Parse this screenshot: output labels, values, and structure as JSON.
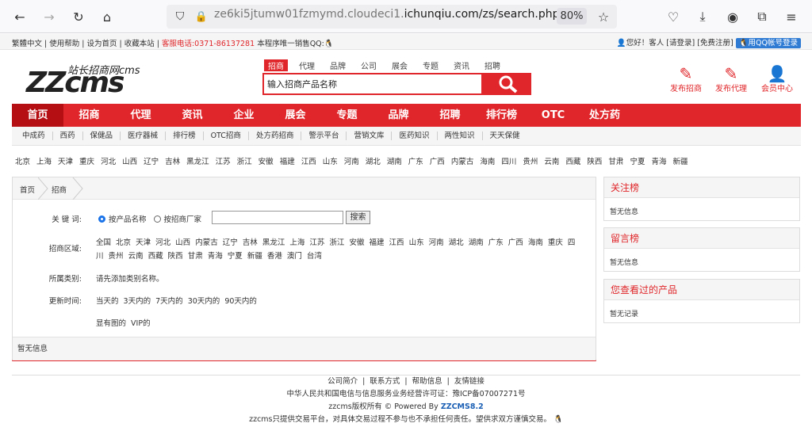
{
  "browser": {
    "url_dim": "ze6ki5jtumw01fzmymd.cloudeci1.",
    "url_main": "ichunqiu.com/zs/search.php",
    "zoom": "80%"
  },
  "topbar": {
    "links": "繁體中文 | 使用帮助 | 设为首页 | 收藏本站 |",
    "phone": "客服电话:0371-86137281",
    "qq_text": "本程序唯一销售QQ:",
    "greeting": "您好！客人",
    "login": "[请登录]",
    "register": "[免费注册]",
    "qq_login": "用QQ帐号登录"
  },
  "logo": {
    "main": "ZZcms",
    "sub": "站长招商网cms"
  },
  "search": {
    "tabs": [
      "招商",
      "代理",
      "品牌",
      "公司",
      "展会",
      "专题",
      "资讯",
      "招聘"
    ],
    "placeholder": "输入招商产品名称"
  },
  "right_links": [
    "发布招商",
    "发布代理",
    "会员中心"
  ],
  "nav": [
    "首页",
    "招商",
    "代理",
    "资讯",
    "企业",
    "展会",
    "专题",
    "品牌",
    "招聘",
    "排行榜",
    "OTC",
    "处方药"
  ],
  "subnav": [
    "中成药",
    "西药",
    "保健品",
    "医疗器械",
    "排行榜",
    "OTC招商",
    "处方药招商",
    "警示平台",
    "营销文库",
    "医药知识",
    "两性知识",
    "天天保健"
  ],
  "cities": [
    "北京",
    "上海",
    "天津",
    "重庆",
    "河北",
    "山西",
    "辽宁",
    "吉林",
    "黑龙江",
    "江苏",
    "浙江",
    "安徽",
    "福建",
    "江西",
    "山东",
    "河南",
    "湖北",
    "湖南",
    "广东",
    "广西",
    "内蒙古",
    "海南",
    "四川",
    "贵州",
    "云南",
    "西藏",
    "陕西",
    "甘肃",
    "宁夏",
    "青海",
    "新疆"
  ],
  "breadcrumb": [
    "首页",
    "招商"
  ],
  "form": {
    "keyword_label": "关 键 词:",
    "opt1": "按产品名称",
    "opt2": "按招商厂家",
    "search_btn": "搜索",
    "region_label": "招商区域:",
    "region_line1": "全国  北京  天津  河北  山西  内蒙古  辽宁  吉林  黑龙江  上海  江苏  浙江  安徽  福建  江西  山东  河南  湖北  湖南  广东  广西  海南  重庆  四",
    "region_line2": "川  贵州  云南  西藏  陕西  甘肃  青海  宁夏  新疆  香港  澳门  台湾",
    "category_label": "所属类别:",
    "category_value": "请先添加类别名称。",
    "time_label": "更新时间:",
    "time_value": "当天的  3天内的  7天内的  30天内的  90天内的",
    "filter_value": "显有图的  VIP的"
  },
  "no_info": "暂无信息",
  "sidebar": [
    {
      "title": "关注榜",
      "body": "暂无信息"
    },
    {
      "title": "留言榜",
      "body": "暂无信息"
    },
    {
      "title": "您查看过的产品",
      "body": "暂无记录"
    }
  ],
  "footer": {
    "links": "公司简介  |  联系方式  |  帮助信息  |  友情链接",
    "license": "中华人民共和国电信与信息服务业务经营许可证：豫ICP备07007271号",
    "powered_pre": "zzcms版权所有 © Powered By ",
    "powered_brand": "ZZCMS8.2",
    "disclaimer": "zzcms只提供交易平台，对具体交易过程不参与也不承担任何责任。望供求双方谨慎交易。"
  }
}
